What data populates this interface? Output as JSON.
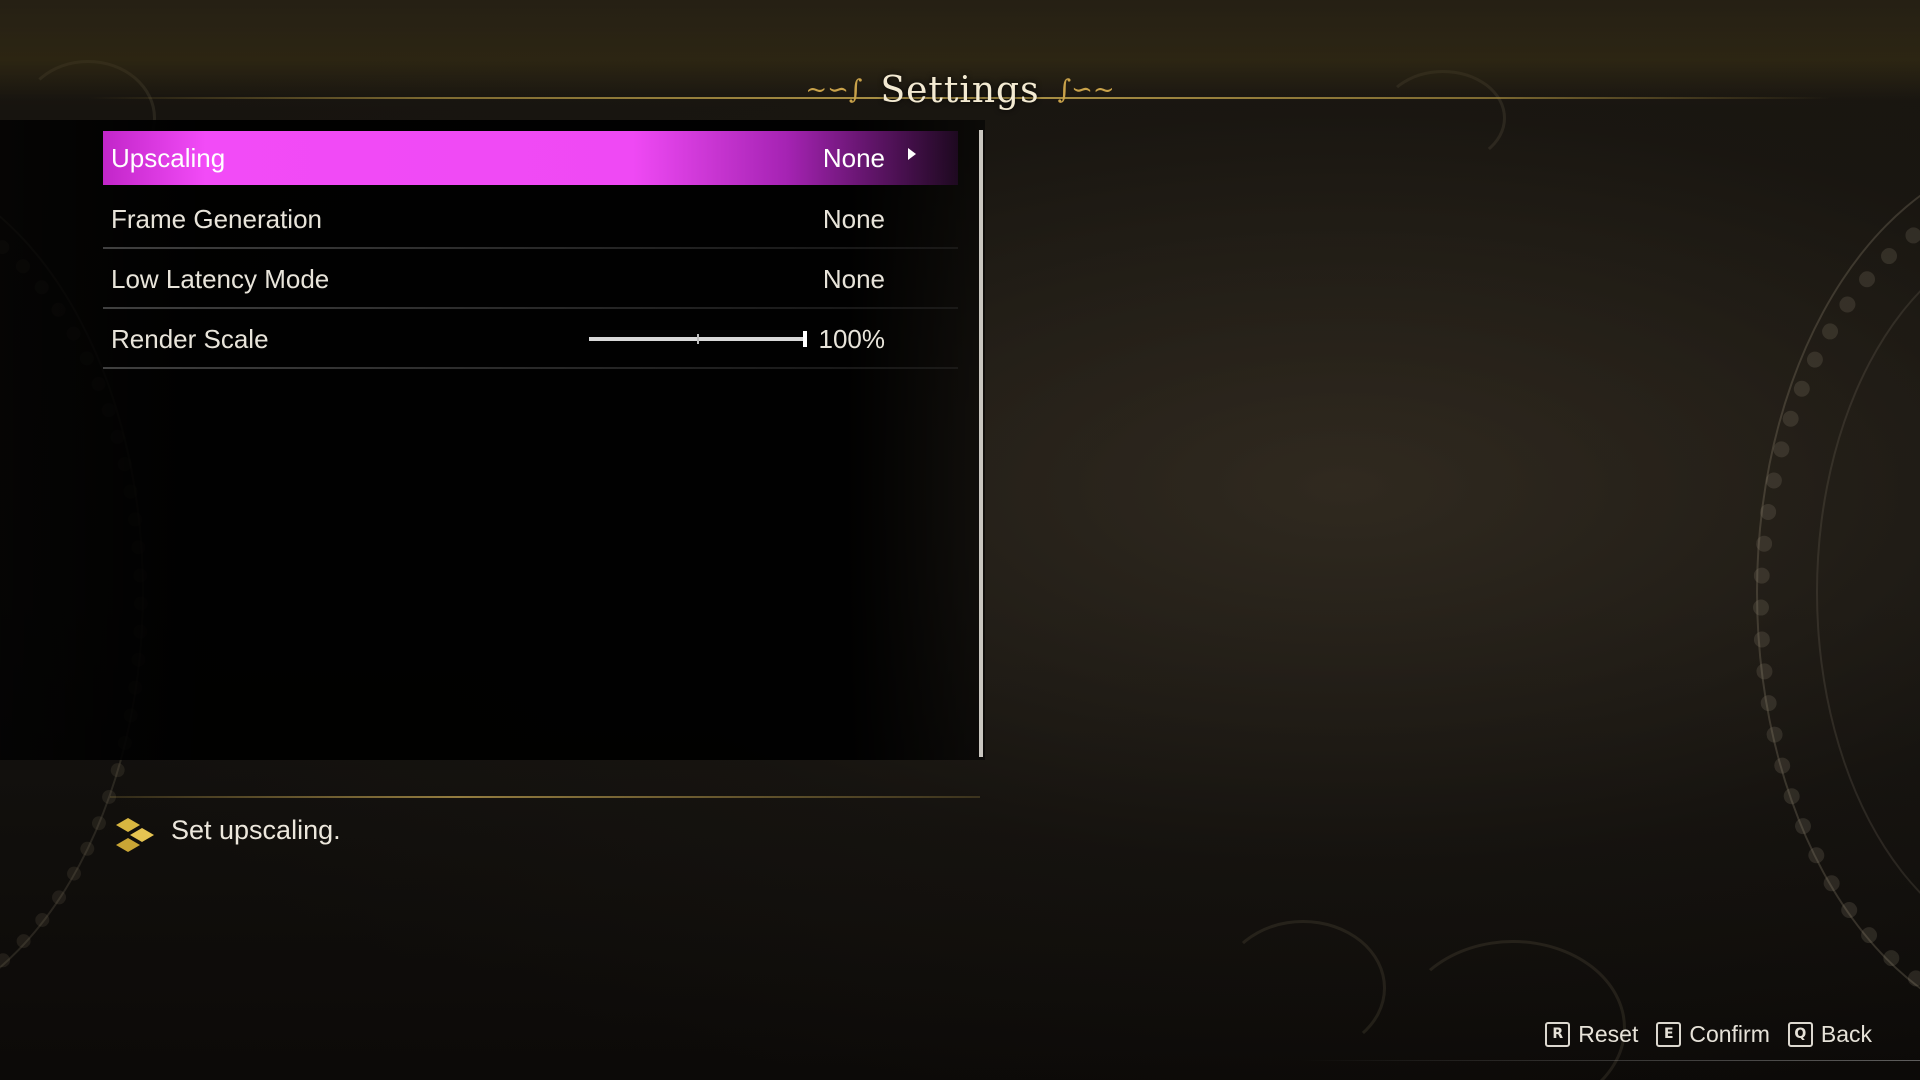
{
  "header": {
    "title": "Settings"
  },
  "settings": {
    "rows": [
      {
        "label": "Upscaling",
        "value": "None"
      },
      {
        "label": "Frame Generation",
        "value": "None"
      },
      {
        "label": "Low Latency Mode",
        "value": "None"
      },
      {
        "label": "Render Scale",
        "value": "100%"
      }
    ],
    "render_scale_level": 1.0,
    "selected_index": 0
  },
  "description": {
    "text": "Set upscaling."
  },
  "hints": [
    {
      "key": "R",
      "label": "Reset"
    },
    {
      "key": "E",
      "label": "Confirm"
    },
    {
      "key": "Q",
      "label": "Back"
    }
  ],
  "colors": {
    "highlight": "#ef49f4",
    "accent_gold": "#c9a24a",
    "text": "#e8e4da"
  },
  "icons": {
    "title_flourish": "scroll-flourish-icon",
    "row_arrow": "chevron-right-icon",
    "description": "diamond-cluster-icon"
  }
}
